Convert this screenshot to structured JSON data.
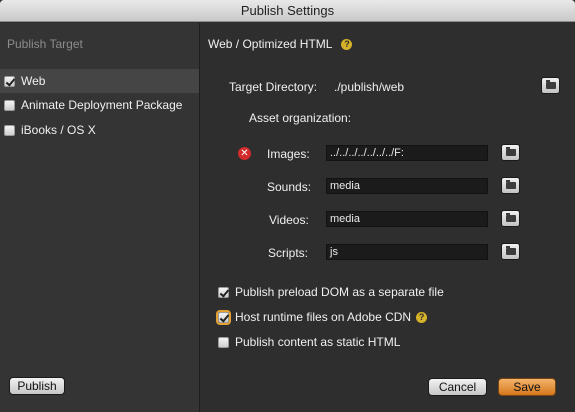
{
  "window": {
    "title": "Publish Settings"
  },
  "sidebar": {
    "header": "Publish Target",
    "targets": [
      {
        "label": "Web",
        "checked": true,
        "selected": true
      },
      {
        "label": "Animate Deployment Package",
        "checked": false,
        "selected": false
      },
      {
        "label": "iBooks / OS X",
        "checked": false,
        "selected": false
      }
    ],
    "publish_button": "Publish"
  },
  "main": {
    "title": "Web / Optimized HTML",
    "target_directory": {
      "label": "Target Directory:",
      "value": "./publish/web"
    },
    "asset_organization_label": "Asset organization:",
    "assets": [
      {
        "label": "Images:",
        "value": "../../../../../../../F:",
        "error": true
      },
      {
        "label": "Sounds:",
        "value": "media",
        "error": false
      },
      {
        "label": "Videos:",
        "value": "media",
        "error": false
      },
      {
        "label": "Scripts:",
        "value": "js",
        "error": false
      }
    ],
    "options": [
      {
        "label": "Publish preload DOM as a separate file",
        "checked": true,
        "help": false
      },
      {
        "label": "Host runtime files on Adobe CDN",
        "checked": true,
        "help": true
      },
      {
        "label": "Publish content as static HTML",
        "checked": false,
        "help": false
      }
    ],
    "cancel_button": "Cancel",
    "save_button": "Save"
  },
  "colors": {
    "accent": "#e5a231",
    "help": "#d6b229",
    "error": "#d12b2b"
  }
}
